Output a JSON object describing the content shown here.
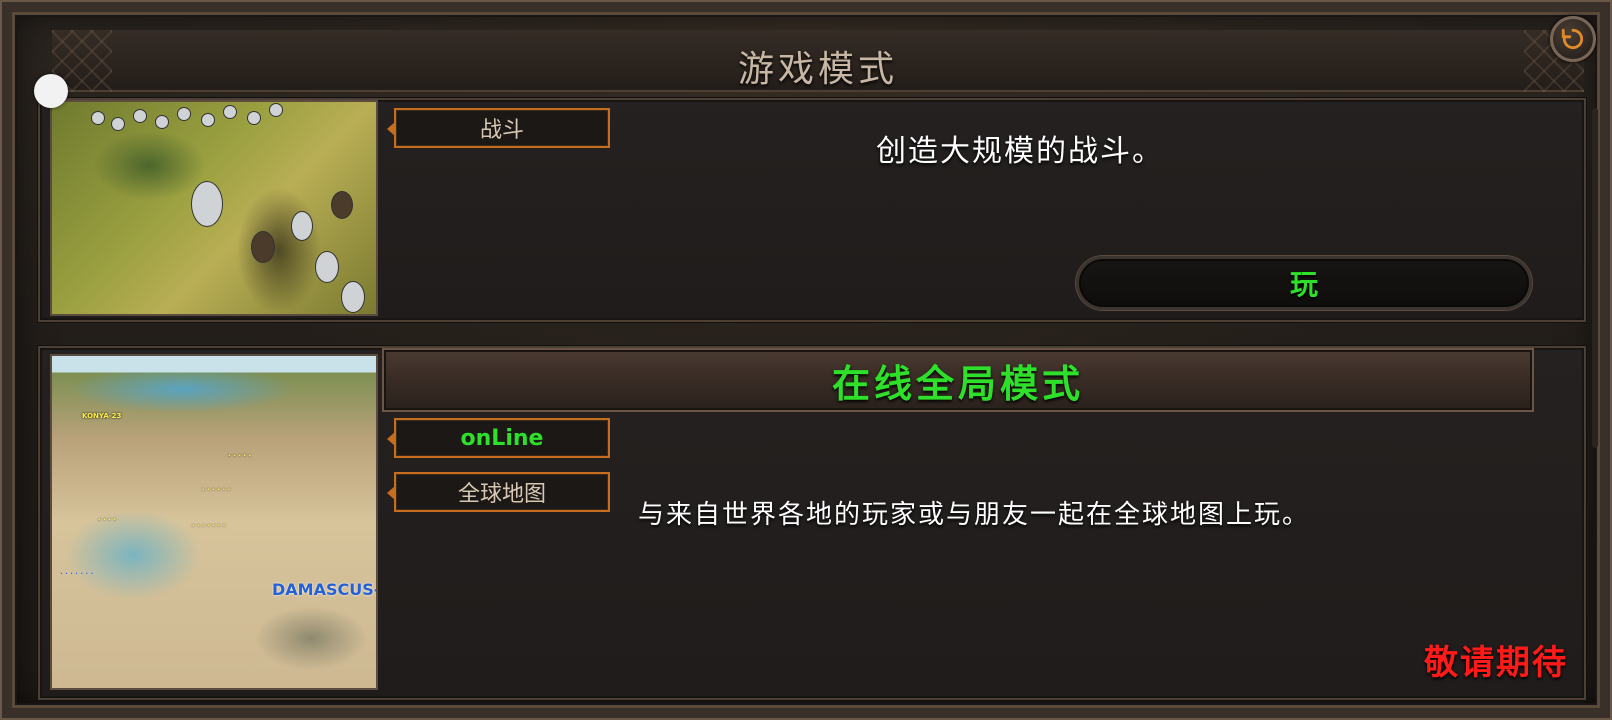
{
  "header": {
    "title": "游戏模式"
  },
  "modes": [
    {
      "tag": "战斗",
      "description": "创造大规模的战斗。",
      "action_label": "玩",
      "thumbnail_icon": "battle-screenshot"
    },
    {
      "section_title": "在线全局模式",
      "tags": [
        "onLine",
        "全球地图"
      ],
      "description": "与来自世界各地的玩家或与朋友一起在全球地图上玩。",
      "status": "敬请期待",
      "thumbnail_icon": "world-map-screenshot",
      "map_labels": {
        "big_city": "DAMASCUS-15",
        "konya": "KONYA-23"
      }
    }
  ],
  "colors": {
    "accent_green": "#2ee02a",
    "tag_border_orange": "#c76d1f",
    "coming_soon_red": "#ff1a1a"
  }
}
